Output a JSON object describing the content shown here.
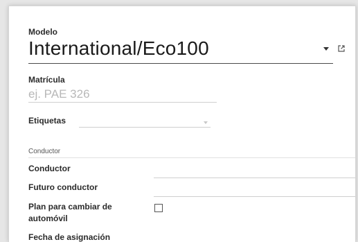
{
  "form": {
    "model": {
      "label": "Modelo",
      "value": "International/Eco100"
    },
    "plate": {
      "label": "Matrícula",
      "placeholder": "ej. PAE 326"
    },
    "tags": {
      "label": "Etiquetas"
    },
    "driver_section": {
      "title": "Conductor",
      "fields": {
        "driver": {
          "label": "Conductor"
        },
        "future_driver": {
          "label": "Futuro conductor"
        },
        "plan_change": {
          "label_line1": "Plan para cambiar de",
          "label_line2": "automóvil",
          "checked": false
        },
        "next_field_cut": {
          "label": "Fecha de asignación"
        }
      }
    }
  },
  "icons": {
    "model_dropdown": "caret-down-icon",
    "external_link": "external-link-icon",
    "tags_dropdown": "caret-down-icon"
  },
  "colors": {
    "text": "#2b2b2b",
    "placeholder": "#b8b8b8",
    "underline": "#cfcfcf"
  }
}
